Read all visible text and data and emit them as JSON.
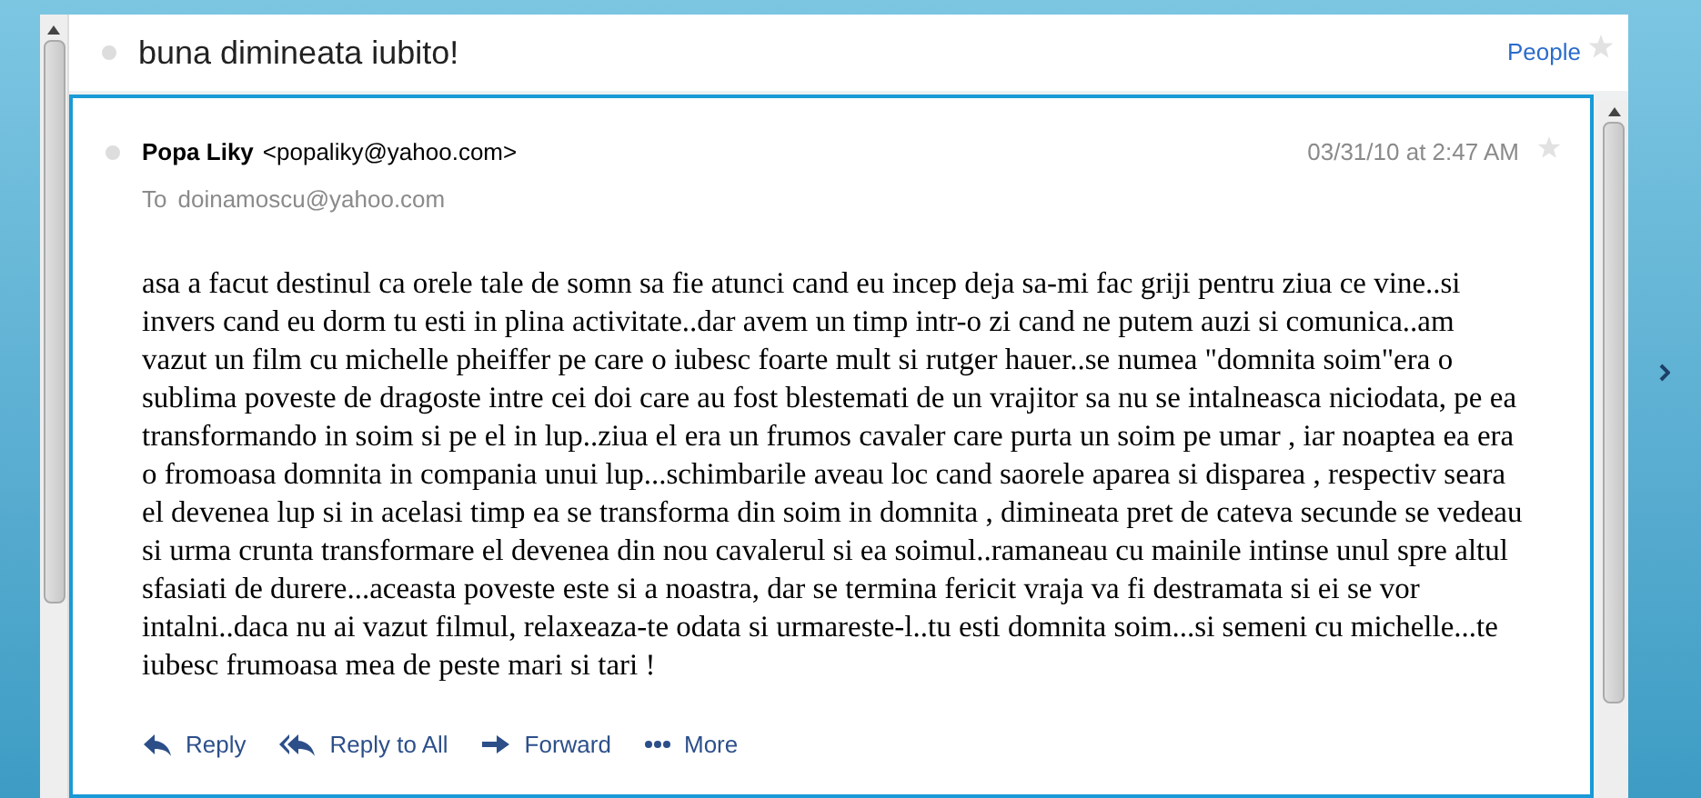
{
  "conversation": {
    "subject": "buna dimineata iubito!",
    "people_link": "People",
    "starred": false
  },
  "message": {
    "sender_name": "Popa Liky",
    "sender_email": "<popaliky@yahoo.com>",
    "to_label": "To",
    "to": "doinamoscu@yahoo.com",
    "date": "03/31/10 at 2:47 AM",
    "starred": false,
    "body": "asa a facut destinul ca orele tale de somn sa fie atunci cand eu incep deja sa-mi fac griji pentru ziua ce vine..si invers cand eu dorm tu esti in plina activitate..dar avem un timp intr-o zi cand ne putem auzi si comunica..am vazut un film cu michelle pheiffer pe care o iubesc foarte mult si rutger hauer..se numea \"domnita soim\"era o sublima poveste de dragoste intre cei doi care au fost blestemati de un vrajitor sa nu se intalneasca niciodata, pe ea transformando in soim si pe el in lup..ziua el era un frumos cavaler care purta un soim pe umar , iar noaptea ea era o fromoasa domnita in compania unui lup...schimbarile aveau loc cand saorele aparea si disparea , respectiv seara el devenea lup si in acelasi timp ea se transforma din soim in domnita , dimineata pret de cateva secunde se vedeau si urma crunta transformare el devenea din nou cavalerul si ea soimul..ramaneau cu mainile intinse unul spre altul sfasiati de durere...aceasta poveste este si a noastra, dar se termina fericit vraja va fi destramata si ei se vor intalni..daca nu ai vazut filmul, relaxeaza-te odata si urmareste-l..tu esti domnita soim...si semeni cu michelle...te iubesc frumoasa mea de peste mari si tari !",
    "actions": [
      {
        "kind": "reply",
        "label": "Reply"
      },
      {
        "kind": "reply_all",
        "label": "Reply to All"
      },
      {
        "kind": "forward",
        "label": "Forward"
      },
      {
        "kind": "more",
        "label": "More"
      }
    ]
  }
}
